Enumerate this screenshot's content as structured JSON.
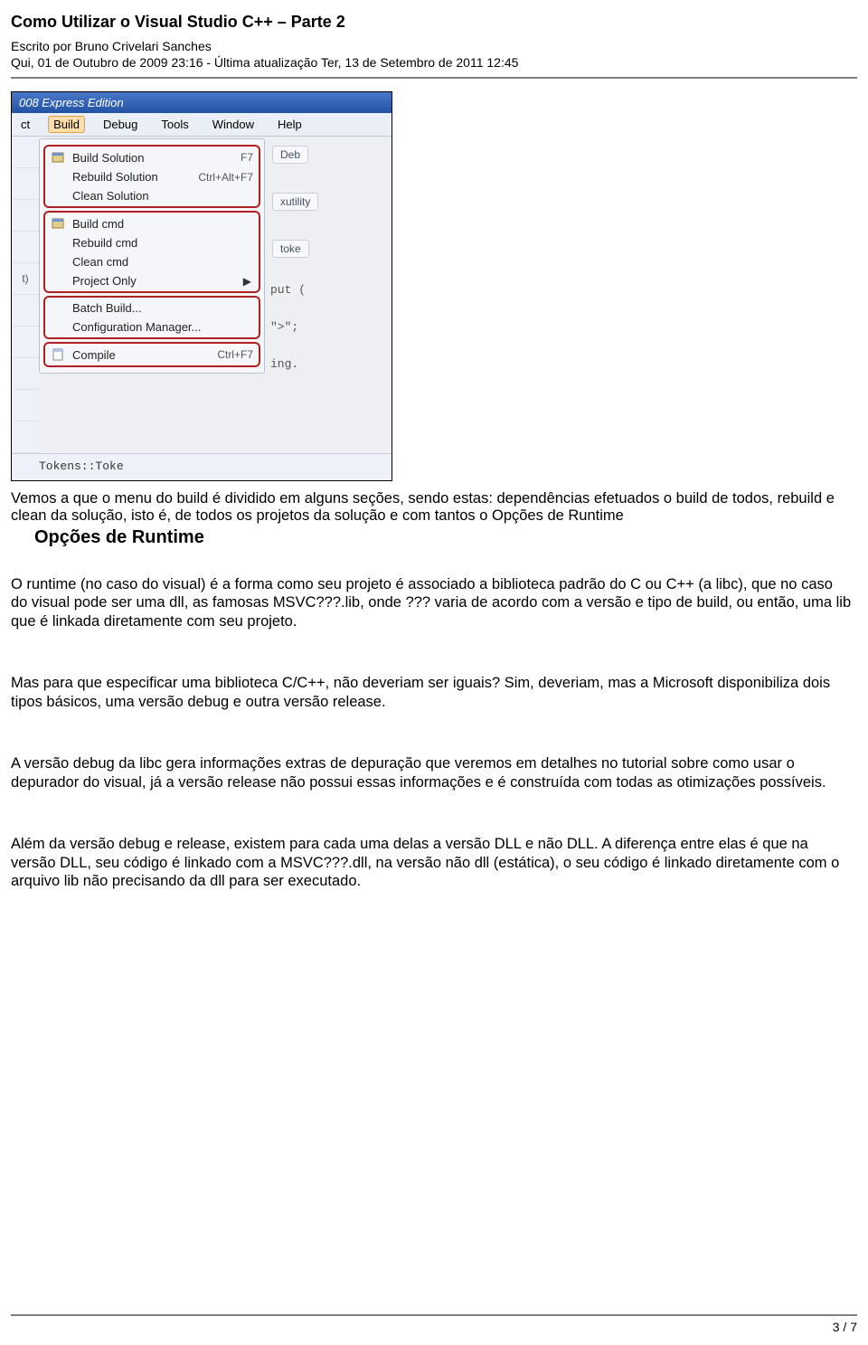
{
  "header": {
    "title": "Como Utilizar o Visual Studio C++ – Parte 2",
    "author_line": "Escrito por Bruno Crivelari Sanches",
    "date_line": "Qui, 01 de Outubro de 2009 23:16 - Última atualização Ter, 13 de Setembro de 2011 12:45"
  },
  "screenshot": {
    "title_fragment": "008 Express Edition",
    "menubar": [
      "ct",
      "Build",
      "Debug",
      "Tools",
      "Window",
      "Help"
    ],
    "left_labels": [
      "",
      "t)"
    ],
    "sections": [
      {
        "items": [
          {
            "icon": "build",
            "label": "Build Solution",
            "shortcut": "F7"
          },
          {
            "icon": "",
            "label": "Rebuild Solution",
            "shortcut": "Ctrl+Alt+F7"
          },
          {
            "icon": "",
            "label": "Clean Solution",
            "shortcut": ""
          }
        ]
      },
      {
        "items": [
          {
            "icon": "build",
            "label": "Build cmd",
            "shortcut": ""
          },
          {
            "icon": "",
            "label": "Rebuild cmd",
            "shortcut": ""
          },
          {
            "icon": "",
            "label": "Clean cmd",
            "shortcut": ""
          },
          {
            "icon": "",
            "label": "Project Only",
            "shortcut": "",
            "submenu": true
          }
        ]
      },
      {
        "items": [
          {
            "icon": "",
            "label": "Batch Build...",
            "shortcut": ""
          },
          {
            "icon": "",
            "label": "Configuration Manager...",
            "shortcut": ""
          }
        ]
      },
      {
        "items": [
          {
            "icon": "compile",
            "label": "Compile",
            "shortcut": "Ctrl+F7"
          }
        ]
      }
    ],
    "right_chips": [
      "Deb",
      "xutility",
      "toke"
    ],
    "right_code": [
      "put (",
      "\">\";",
      "ing."
    ],
    "footer_code": "Tokens::Toke"
  },
  "garbled_block": "Vemos a que o menu do build é dividido em alguns seções, sendo estas: dependências efetuados o build de todos, rebuild e clean da solução, isto é, de todos os projetos da solução e com tantos o Opções de Runtime",
  "section_title": "Opções de Runtime",
  "paragraphs": [
    "O runtime (no caso do visual) é a forma como seu projeto é associado a biblioteca padrão do C ou C++ (a libc), que no caso do visual pode ser uma dll, as famosas MSVC???.lib, onde ??? varia de acordo com a versão e tipo de build, ou então, uma lib que é linkada diretamente com seu projeto.",
    "Mas para que especificar uma biblioteca C/C++, não deveriam ser iguais? Sim, deveriam, mas a Microsoft disponibiliza dois tipos básicos, uma versão debug e outra versão release.",
    "A versão debug da libc gera informações extras de depuração que veremos em detalhes no tutorial sobre como usar o depurador do visual, já a versão release não possui essas informações e é construída com todas as otimizações possíveis.",
    "Além da versão debug e release, existem para cada uma delas a versão DLL e não DLL. A diferença entre elas é que na versão DLL, seu código é linkado com a MSVC???.dll, na versão não dll (estática), o seu código é linkado diretamente com o arquivo lib não precisando da dll para ser executado."
  ],
  "page_number": "3 / 7"
}
